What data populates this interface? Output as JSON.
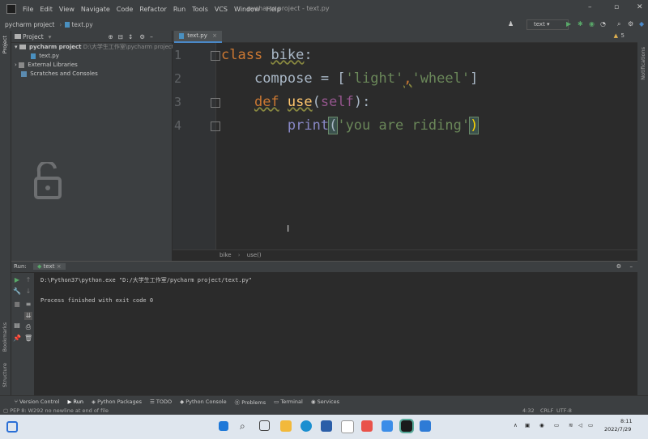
{
  "menu": {
    "items": [
      "File",
      "Edit",
      "View",
      "Navigate",
      "Code",
      "Refactor",
      "Run",
      "Tools",
      "VCS",
      "Window",
      "Help"
    ],
    "window_title": "pycharm project - text.py"
  },
  "navbar": {
    "project": "pycharm project",
    "file": "text.py",
    "run_config": "text"
  },
  "project_panel": {
    "title": "Project",
    "root_name": "pycharm project",
    "root_path": "D:\\大学生工作室\\pycharm project",
    "file": "text.py",
    "external": "External Libraries",
    "scratches": "Scratches and Consoles"
  },
  "editor": {
    "tab": "text.py",
    "line_numbers": [
      "1",
      "2",
      "3",
      "4"
    ],
    "breadcrumb_1": "bike",
    "breadcrumb_2": "use()",
    "warning_count": "5"
  },
  "code": {
    "l1_kw": "class",
    "l1_name": "bike",
    "l1_colon": ":",
    "l2_var": "compose = [",
    "l2_s1": "'light'",
    "l2_comma": ",",
    "l2_s2": "'wheel'",
    "l2_end": "]",
    "l3_kw": "def",
    "l3_fn": "use",
    "l3_p1": "(",
    "l3_self": "self",
    "l3_p2": "):",
    "l4_fn": "print",
    "l4_p1": "(",
    "l4_str": "'you are riding'",
    "l4_p2": ")"
  },
  "run_panel": {
    "label": "Run:",
    "tab": "text",
    "cmd": "D:\\Python37\\python.exe \"D:/大学生工作室/pycharm project/text.py\"",
    "result": "Process finished with exit code 0"
  },
  "bottom_tabs": [
    "Version Control",
    "Run",
    "Python Packages",
    "TODO",
    "Python Console",
    "Problems",
    "Terminal",
    "Services"
  ],
  "left_strip": {
    "project": "Project",
    "bookmarks": "Bookmarks",
    "structure": "Structure"
  },
  "right_strip": {
    "notifications": "Notifications"
  },
  "status": {
    "message": "PEP 8: W292 no newline at end of file",
    "position": "4:32",
    "line_sep": "CRLF",
    "encoding": "UTF-8"
  },
  "taskbar": {
    "time": "8:11",
    "date": "2022/7/29"
  },
  "colors": {
    "keyword": "#cc7832",
    "function": "#ffc66d",
    "string": "#6a8759",
    "self": "#94558d",
    "accent": "#4a88c7"
  }
}
